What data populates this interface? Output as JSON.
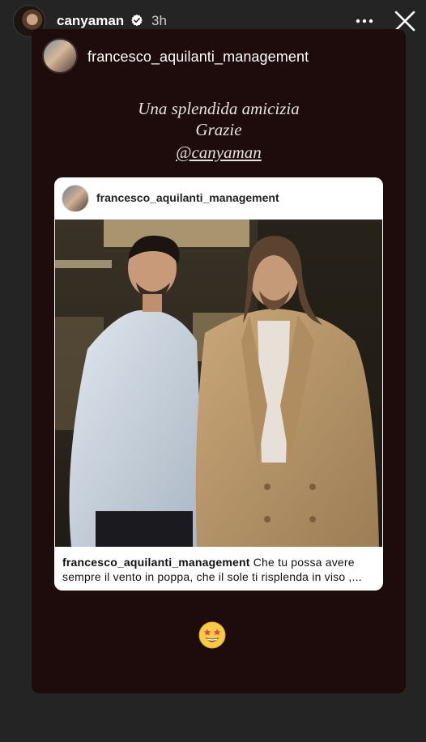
{
  "header": {
    "username": "canyaman",
    "time": "3h"
  },
  "story": {
    "author": "francesco_aquilanti_management",
    "caption_lines": [
      "Una splendida amicizia",
      "Grazie",
      "@canyaman"
    ],
    "post": {
      "username": "francesco_aquilanti_management",
      "caption_user": "francesco_aquilanti_management",
      "caption_text": "Che tu possa avere sempre il vento in poppa, che il sole ti risplenda in viso ,..."
    },
    "sticker": "star-struck-emoji"
  },
  "icons": {
    "verified": "verified-badge-icon",
    "more": "more-horizontal-icon",
    "close": "close-icon"
  },
  "colors": {
    "background": "#242424",
    "story_card": "#1e0b0b",
    "verified_badge": "#ffffff"
  }
}
